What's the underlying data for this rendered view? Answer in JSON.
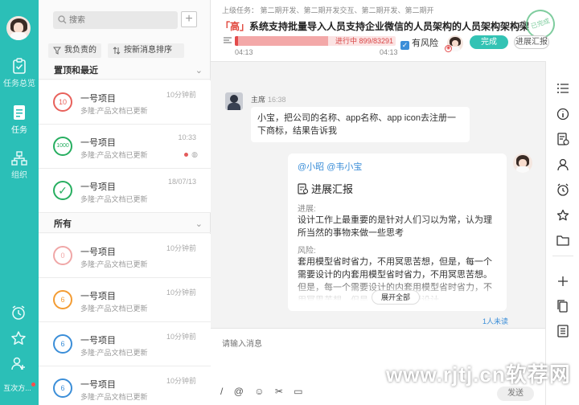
{
  "nav": {
    "items": [
      {
        "label": "任务总览",
        "icon": "clipboard-check-icon"
      },
      {
        "label": "任务",
        "icon": "document-icon"
      },
      {
        "label": "组织",
        "icon": "org-chart-icon"
      }
    ],
    "bottom_icons": [
      "alarm-clock-icon",
      "star-icon",
      "user-add-icon"
    ],
    "more_label": "互次方..."
  },
  "list": {
    "search_placeholder": "搜索",
    "filters": [
      "我负责的",
      "按新消息排序"
    ],
    "sections": {
      "pinned": "置顶和最近",
      "all": "所有"
    },
    "pinned_items": [
      {
        "badge": "10",
        "title": "一号项目",
        "sub": "多隆:产品文档已更新",
        "time": "10分钟前",
        "ring": "#e8615b"
      },
      {
        "badge": "1000",
        "title": "一号项目",
        "sub": "多隆:产品文档已更新",
        "time": "10:33",
        "ring": "#27ae60"
      },
      {
        "badge": "✓",
        "title": "一号项目",
        "sub": "多隆:产品文档已更新",
        "time": "18/07/13",
        "ring": "#27ae60"
      }
    ],
    "all_items": [
      {
        "badge": "0",
        "title": "一号项目",
        "sub": "多隆:产品文档已更新",
        "time": "10分钟前",
        "ring": "#f0a7a7"
      },
      {
        "badge": "6",
        "title": "一号项目",
        "sub": "多隆:产品文档已更新",
        "time": "10分钟前",
        "ring": "#f39c33"
      },
      {
        "badge": "6",
        "title": "一号项目",
        "sub": "多隆:产品文档已更新",
        "time": "10分钟前",
        "ring": "#3b8ed8"
      },
      {
        "badge": "6",
        "title": "一号项目",
        "sub": "多隆:产品文档已更新",
        "time": "10分钟前",
        "ring": "#3b8ed8"
      }
    ]
  },
  "task": {
    "breadcrumb": "上级任务：  第二期开发、第二期开发交互、第二期开发、第二期开",
    "priority": "「高」",
    "title": "系统支持批量导入人员支持企业微信的人员架构的人员架构架构架",
    "stamp": "已完成",
    "progress_text": "进行中 899/83291",
    "progress_value": 0.58,
    "time_start": "04:13",
    "time_end": "04:13",
    "risk_label": "有风险",
    "done_label": "完成",
    "report_label": "进展汇报"
  },
  "chat": {
    "msg1": {
      "name": "主席",
      "time": "16:38",
      "text": "小宝，把公司的名称、app名称、app icon去注册一下商标，结果告诉我"
    },
    "card": {
      "mention": "@小昭 @韦小宝",
      "title": "进展汇报",
      "progress_label": "进展:",
      "progress_text": "设计工作上最重要的是针对人们习以为常，认为理所当然的事物来做一些思考",
      "risk_label": "风险:",
      "risk_text": "套用模型省时省力，不用冥思苦想，但是，每一个需要设计的内套用模型省时省力，不用冥思苦想。但是，每一个需要设计的内套用模型省时省力，不用冥思苦想。但是，每一个需要设计",
      "expand_label": "展开全部"
    },
    "unread": "1人未读",
    "input_placeholder": "请输入消息",
    "send_label": "发送",
    "tools": [
      "/",
      "@",
      "☺",
      "✂",
      "▭"
    ]
  },
  "right_toolbar": [
    "list-icon",
    "info-icon",
    "file-check-icon",
    "person-icon",
    "alarm-clock-icon",
    "star-icon",
    "folder-icon",
    "plus-icon",
    "copy-icon",
    "document-list-icon"
  ],
  "watermark": "www.rjtj.cn软荐网"
}
